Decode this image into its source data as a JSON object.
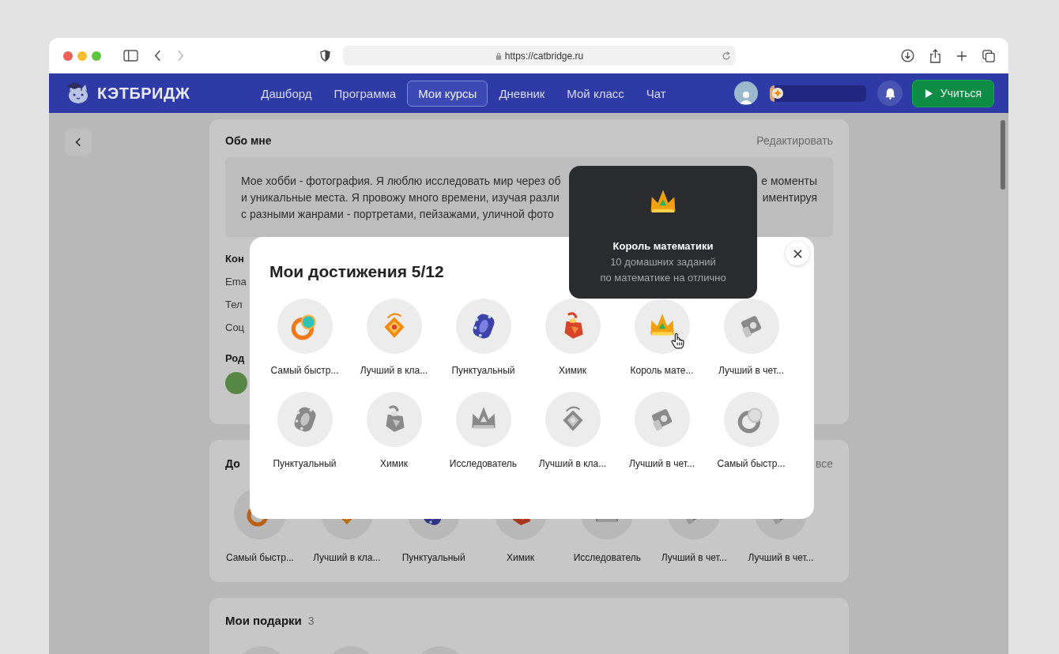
{
  "browser": {
    "url": "https://catbridge.ru",
    "forward_disabled": true
  },
  "header": {
    "logo": "КЭТБРИДЖ",
    "nav": [
      {
        "label": "Дашборд",
        "selected": false
      },
      {
        "label": "Программа",
        "selected": false
      },
      {
        "label": "Мои курсы",
        "selected": true
      },
      {
        "label": "Дневник",
        "selected": false
      },
      {
        "label": "Мой класс",
        "selected": false
      },
      {
        "label": "Чат",
        "selected": false
      }
    ],
    "progress": {
      "level": 0.05
    },
    "learn_button": "Учиться"
  },
  "about": {
    "title": "Обо мне",
    "edit": "Редактировать",
    "lines": [
      {
        "left": "Мое хобби - фотография. Я люблю исследовать мир через об",
        "right": "е моменты"
      },
      {
        "left": "и уникальные места. Я провожу много времени, изучая разли",
        "right": "иментируя"
      },
      {
        "left": "с разными жанрами - портретами, пейзажами, уличной фото"
      }
    ]
  },
  "contacts": {
    "title": "Кон",
    "fields": [
      "Ema",
      "Тел",
      "Соц"
    ]
  },
  "parents": {
    "title": "Род"
  },
  "achievements_card": {
    "title": "До",
    "all_link": "все",
    "items": [
      {
        "label": "Самый быстр...",
        "earned": true
      },
      {
        "label": "Лучший в кла...",
        "earned": true
      },
      {
        "label": "Пунктуальный",
        "earned": true
      },
      {
        "label": "Химик",
        "earned": true
      },
      {
        "label": "Исследователь",
        "earned": false
      },
      {
        "label": "Лучший в чет...",
        "earned": false
      },
      {
        "label": "Лучший в чет...",
        "earned": false
      }
    ]
  },
  "gifts": {
    "title": "Мои подарки",
    "count": "3"
  },
  "modal": {
    "title": "Мои достижения 5/12",
    "items": [
      {
        "label": "Самый быстр...",
        "earned": true,
        "hovered": false
      },
      {
        "label": "Лучший в кла...",
        "earned": true,
        "hovered": false
      },
      {
        "label": "Пунктуальный",
        "earned": true,
        "hovered": false
      },
      {
        "label": "Химик",
        "earned": true,
        "hovered": false
      },
      {
        "label": "Король мате...",
        "earned": true,
        "hovered": true
      },
      {
        "label": "Лучший в чет...",
        "earned": false,
        "hovered": false
      },
      {
        "label": "Пунктуальный",
        "earned": false,
        "hovered": false
      },
      {
        "label": "Химик",
        "earned": false,
        "hovered": false
      },
      {
        "label": "Исследователь",
        "earned": false,
        "hovered": false
      },
      {
        "label": "Лучший в кла...",
        "earned": false,
        "hovered": false
      },
      {
        "label": "Лучший в чет...",
        "earned": false,
        "hovered": false
      },
      {
        "label": "Самый быстр...",
        "earned": false,
        "hovered": false
      }
    ]
  },
  "tooltip": {
    "title": "Король математики",
    "lines": [
      "10 домашних заданий",
      "по математике на отлично"
    ]
  }
}
